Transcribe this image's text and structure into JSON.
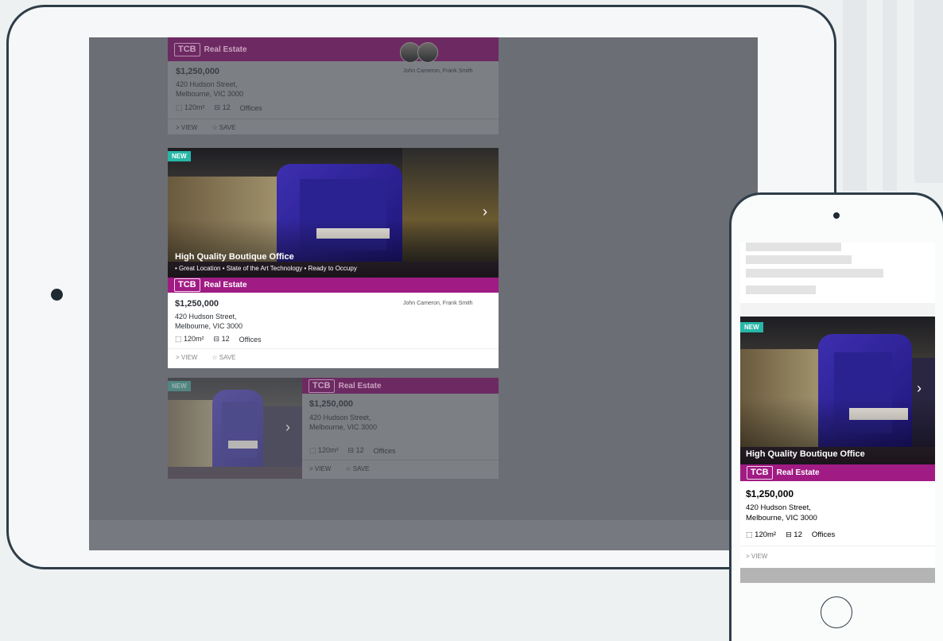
{
  "listing": {
    "brand_logo": "TCB",
    "brand_name": "Real Estate",
    "badge": "NEW",
    "title": "High Quality Boutique Office",
    "features_line": "• Great Location  •  State of the Art Technology  •  Ready to Occupy",
    "price": "$1,250,000",
    "address_line1": "420 Hudson Street,",
    "address_line2": "Melbourne, VIC 3000",
    "area": "120m²",
    "parking": "12",
    "type": "Offices",
    "agents": "John Cameron, Frank Smith",
    "view_label": "> VIEW",
    "save_label": "☆ SAVE"
  },
  "colors": {
    "brand": "#a01b84",
    "badge": "#27b6a7",
    "device_frame": "#2e3d48"
  },
  "icons": [
    "area-icon",
    "parking-icon",
    "chevron-right-icon",
    "star-icon",
    "camera-icon",
    "home-button-icon"
  ]
}
